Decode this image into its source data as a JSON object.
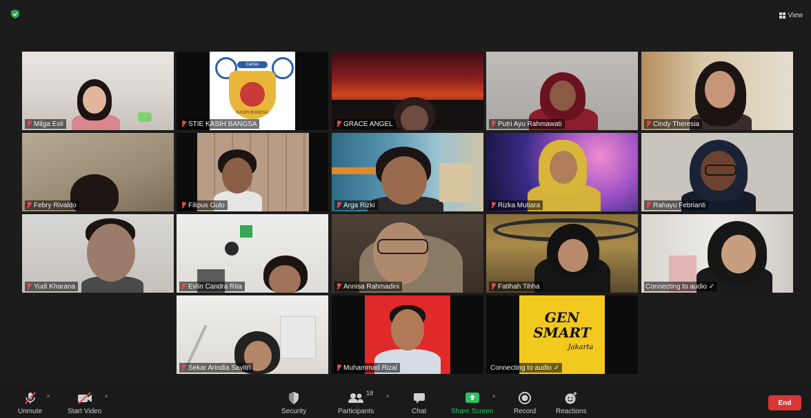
{
  "topbar": {
    "view_label": "View"
  },
  "participants": [
    {
      "name": "Milga Esli"
    },
    {
      "name": "STIE KASIH BANGSA"
    },
    {
      "name": "GRACE ANGEL"
    },
    {
      "name": "Putri Ayu Rahmawati"
    },
    {
      "name": "Cindy Theresia"
    },
    {
      "name": "Febry Rivaldo"
    },
    {
      "name": "Filipus Gulo"
    },
    {
      "name": "Arga Rizki"
    },
    {
      "name": "Rizka Mutiara"
    },
    {
      "name": "Rahayu Febrianti"
    },
    {
      "name": "Yudi Kharana"
    },
    {
      "name": "Evlin Candra Rita"
    },
    {
      "name": "Annisa Rahmadini"
    },
    {
      "name": "Fatihah Tihha"
    },
    {
      "name": "Connecting to audio ✓"
    },
    {
      "name": "Sekar Arindia Savitri"
    },
    {
      "name": "Muhammad Rizal"
    },
    {
      "name": "Connecting to audio ✓"
    }
  ],
  "logo_tile": {
    "banner": "Caritas",
    "emblem_text": "KASIH BANGSA"
  },
  "gensmart_tile": {
    "line1": "GEN",
    "line2": "SMART",
    "line3": "Jakarta"
  },
  "toolbar": {
    "unmute": "Unmute",
    "start_video": "Start Video",
    "security": "Security",
    "participants": "Participants",
    "participants_count": "18",
    "chat": "Chat",
    "share_screen": "Share Screen",
    "record": "Record",
    "reactions": "Reactions",
    "end": "End"
  },
  "colors": {
    "active_speaker_border": "#c9e25b",
    "share_green": "#2cc162",
    "end_red": "#d93636",
    "muted_red": "#e34b4b",
    "shield_green": "#2ea84c"
  }
}
